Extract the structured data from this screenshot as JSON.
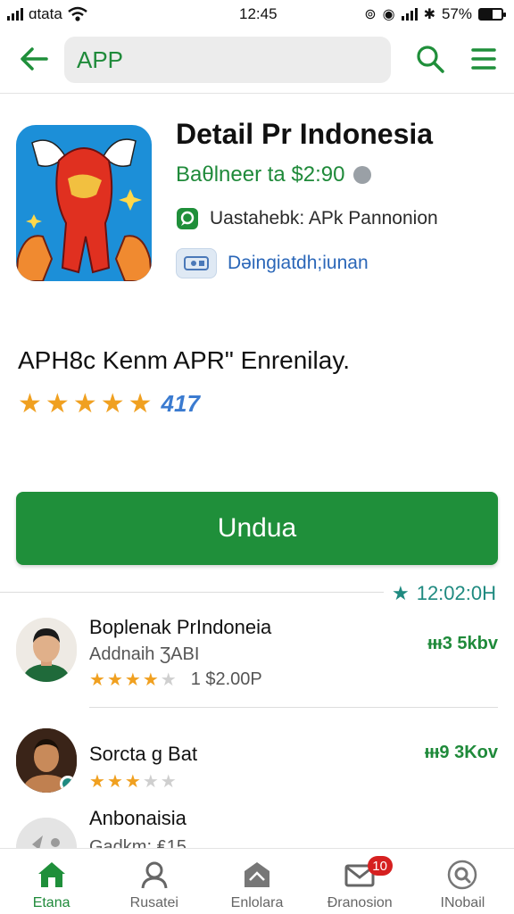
{
  "status_bar": {
    "carrier": "ɑtata",
    "time": "12:45",
    "battery": "57%",
    "battery_level": 0.57
  },
  "header": {
    "search_value": "APP"
  },
  "app": {
    "title": "Detail Pr Indonesia",
    "price_line": "Baθlneer ta $2:90",
    "info_line": "Uastahebk: APk Pannonion",
    "download_info": "Dəingiatdh;iunan"
  },
  "rating_section": {
    "title": "APH8c Kenm APR\" Enrenilay.",
    "stars": 5,
    "rating_count": "417"
  },
  "download_button": {
    "label": "Undua"
  },
  "time_tag": "12:02:0H",
  "list": [
    {
      "name": "Boplenak PrIndoneia",
      "subtitle": "Addnaih ƷABI",
      "rating": 3.5,
      "price": "1 $2.00P",
      "size": "ᵼᵼᵼ3 5kbv",
      "avatar": "person-avatar-green"
    },
    {
      "name": "Sorcta g Bat",
      "subtitle": "",
      "rating": 3,
      "price": "",
      "size": "ᵼᵼᵼ9 3Kov",
      "avatar": "person-avatar-brown"
    },
    {
      "name": "Anbonaisia",
      "subtitle": "Gadkm: ₤15",
      "rating": 0,
      "price": "",
      "size": "",
      "avatar": "app-avatar-grey"
    }
  ],
  "bottom_nav": [
    {
      "label": "Etana",
      "icon": "home-icon",
      "active": true
    },
    {
      "label": "Rusatei",
      "icon": "profile-icon",
      "active": false
    },
    {
      "label": "Enlolara",
      "icon": "explore-icon",
      "active": false
    },
    {
      "label": "Ðranosion",
      "icon": "mail-icon",
      "active": false,
      "badge": "10"
    },
    {
      "label": "INobail",
      "icon": "search-circle-icon",
      "active": false
    }
  ],
  "colors": {
    "accent_green": "#1f8f3a",
    "star_orange": "#f0a020",
    "link_blue": "#2a66b8",
    "badge_red": "#d62020"
  }
}
